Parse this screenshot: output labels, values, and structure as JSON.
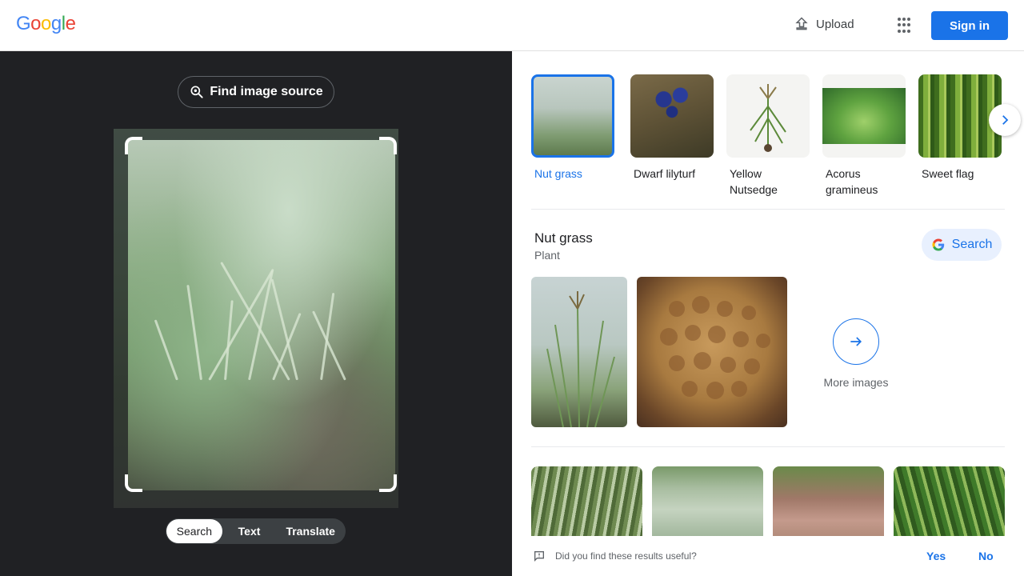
{
  "header": {
    "logo_letters": [
      {
        "ch": "G",
        "color": "#4285f4"
      },
      {
        "ch": "o",
        "color": "#ea4335"
      },
      {
        "ch": "o",
        "color": "#fbbc05"
      },
      {
        "ch": "g",
        "color": "#4285f4"
      },
      {
        "ch": "l",
        "color": "#34a853"
      },
      {
        "ch": "e",
        "color": "#ea4335"
      }
    ],
    "upload_label": "Upload",
    "upload_icon": "upload-icon",
    "apps_icon": "apps-grid-icon",
    "signin_label": "Sign in"
  },
  "left_panel": {
    "find_source_label": "Find image source",
    "find_source_icon": "lens-search-icon",
    "mode_tabs": [
      {
        "label": "Search",
        "active": true
      },
      {
        "label": "Text",
        "active": false
      },
      {
        "label": "Translate",
        "active": false
      }
    ]
  },
  "related": {
    "items": [
      {
        "label": "Nut grass",
        "selected": true
      },
      {
        "label": "Dwarf lilyturf",
        "selected": false
      },
      {
        "label": "Yellow Nutsedge",
        "selected": false
      },
      {
        "label": "Acorus gramineus",
        "selected": false
      },
      {
        "label": "Sweet flag",
        "selected": false
      }
    ],
    "next_icon": "chevron-right-icon"
  },
  "knowledge": {
    "title": "Nut grass",
    "subtitle": "Plant",
    "search_label": "Search",
    "more_images_label": "More images"
  },
  "feedback": {
    "question": "Did you find these results useful?",
    "yes_label": "Yes",
    "no_label": "No"
  },
  "colors": {
    "accent": "#1a73e8",
    "left_bg": "#202124"
  }
}
